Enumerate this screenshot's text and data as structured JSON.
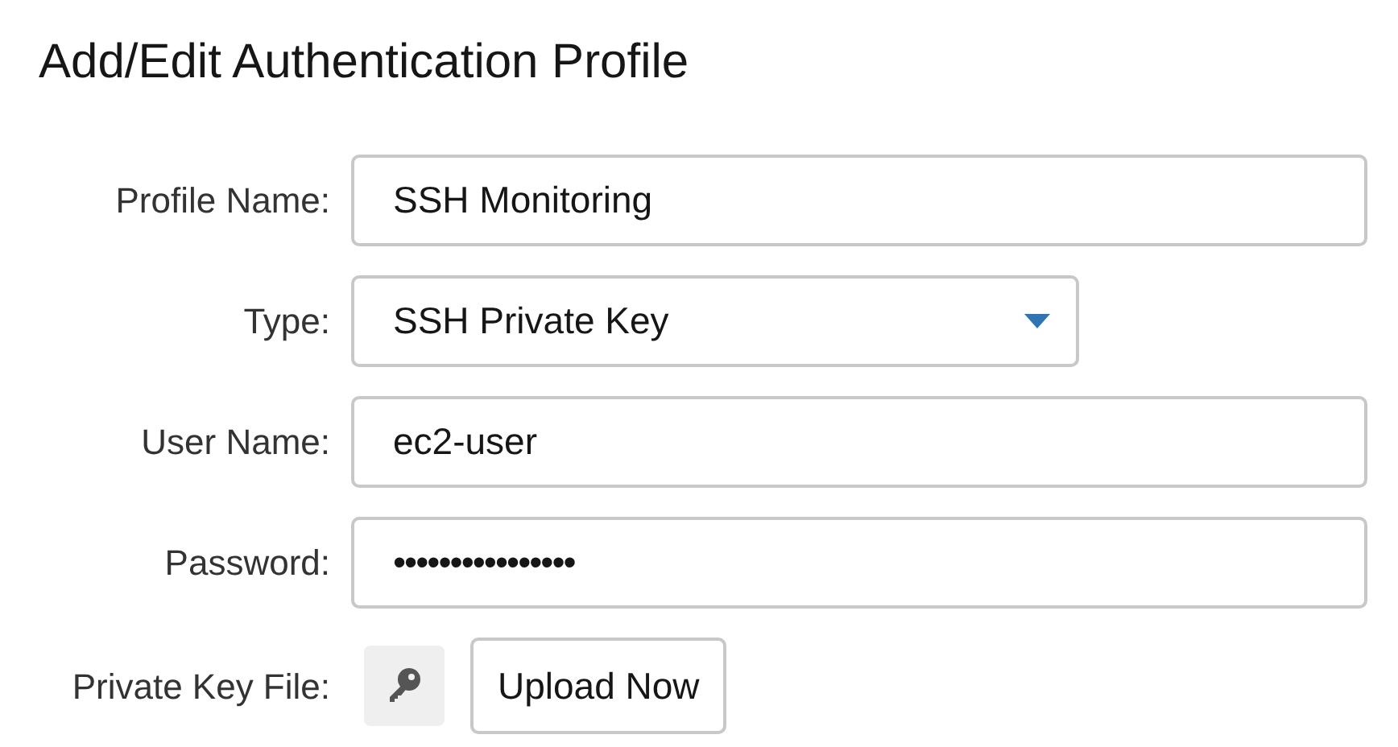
{
  "title": "Add/Edit Authentication Profile",
  "fields": [
    {
      "kind": "text",
      "label": "Profile Name:",
      "value": "SSH Monitoring"
    },
    {
      "kind": "select",
      "label": "Type:",
      "value": "SSH Private Key"
    },
    {
      "kind": "text",
      "label": "User Name:",
      "value": "ec2-user"
    },
    {
      "kind": "password",
      "label": "Password:",
      "value": "••••••••••••••••"
    },
    {
      "kind": "file",
      "label": "Private Key File:",
      "button": "Upload Now"
    }
  ]
}
